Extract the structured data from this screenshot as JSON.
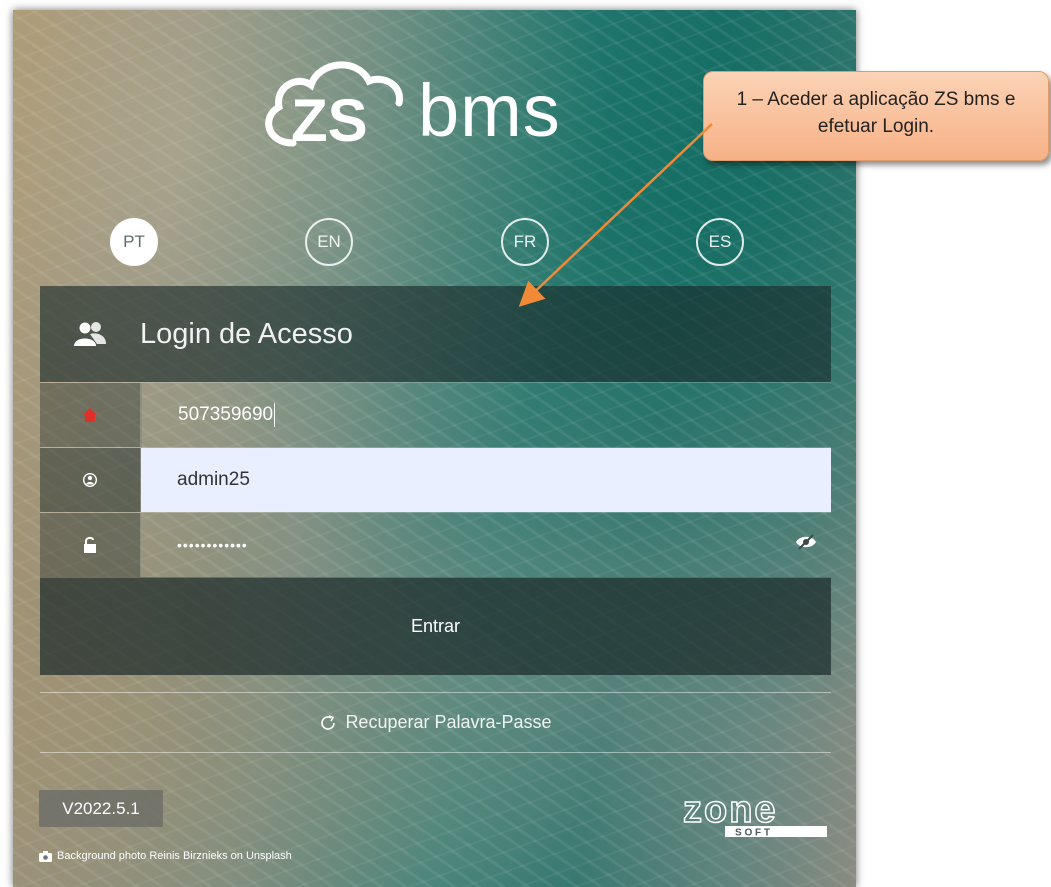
{
  "app": {
    "logo_text": "bms",
    "logo_mark": "ZS"
  },
  "languages": [
    {
      "code": "PT",
      "active": true
    },
    {
      "code": "EN",
      "active": false
    },
    {
      "code": "FR",
      "active": false
    },
    {
      "code": "ES",
      "active": false
    }
  ],
  "login": {
    "title": "Login de Acesso",
    "company_value": "507359690",
    "username_value": "admin25",
    "password_value": "••••••••••••",
    "submit_label": "Entrar"
  },
  "recover_label": "Recuperar Palavra-Passe",
  "version": "V2022.5.1",
  "brand": {
    "name": "zone",
    "sub": "S O F T"
  },
  "photo_credit": "Background photo Reinis Birznieks on Unsplash",
  "callout": {
    "text": "1 – Aceder a aplicação ZS bms e efetuar Login."
  },
  "colors": {
    "callout_fill": "#f7b186",
    "arrow": "#f08a36",
    "company_icon": "#e0302a",
    "username_field_bg": "#e9efff"
  }
}
